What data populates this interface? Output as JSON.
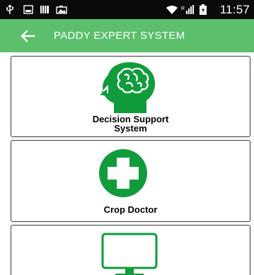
{
  "status_bar": {
    "time": "11:57",
    "icons": [
      "usb-icon",
      "image-icon",
      "barcode-icon",
      "photo-icon",
      "wifi-icon",
      "signal-icon",
      "battery-icon"
    ]
  },
  "app_bar": {
    "title": "PADDY EXPERT SYSTEM",
    "back_icon": "arrow-left-icon",
    "background": "#5cbf6b"
  },
  "menu": {
    "items": [
      {
        "label_line1": "Decision Support",
        "label_line2": "System",
        "icon": "brain-head-icon"
      },
      {
        "label": "Crop Doctor",
        "icon": "plus-circle-icon"
      },
      {
        "label": "",
        "icon": "computer-icon"
      }
    ]
  },
  "colors": {
    "accent_green": "#109c3b",
    "app_bar_green": "#5cbf6b",
    "status_bar": "#0b0b0b"
  }
}
